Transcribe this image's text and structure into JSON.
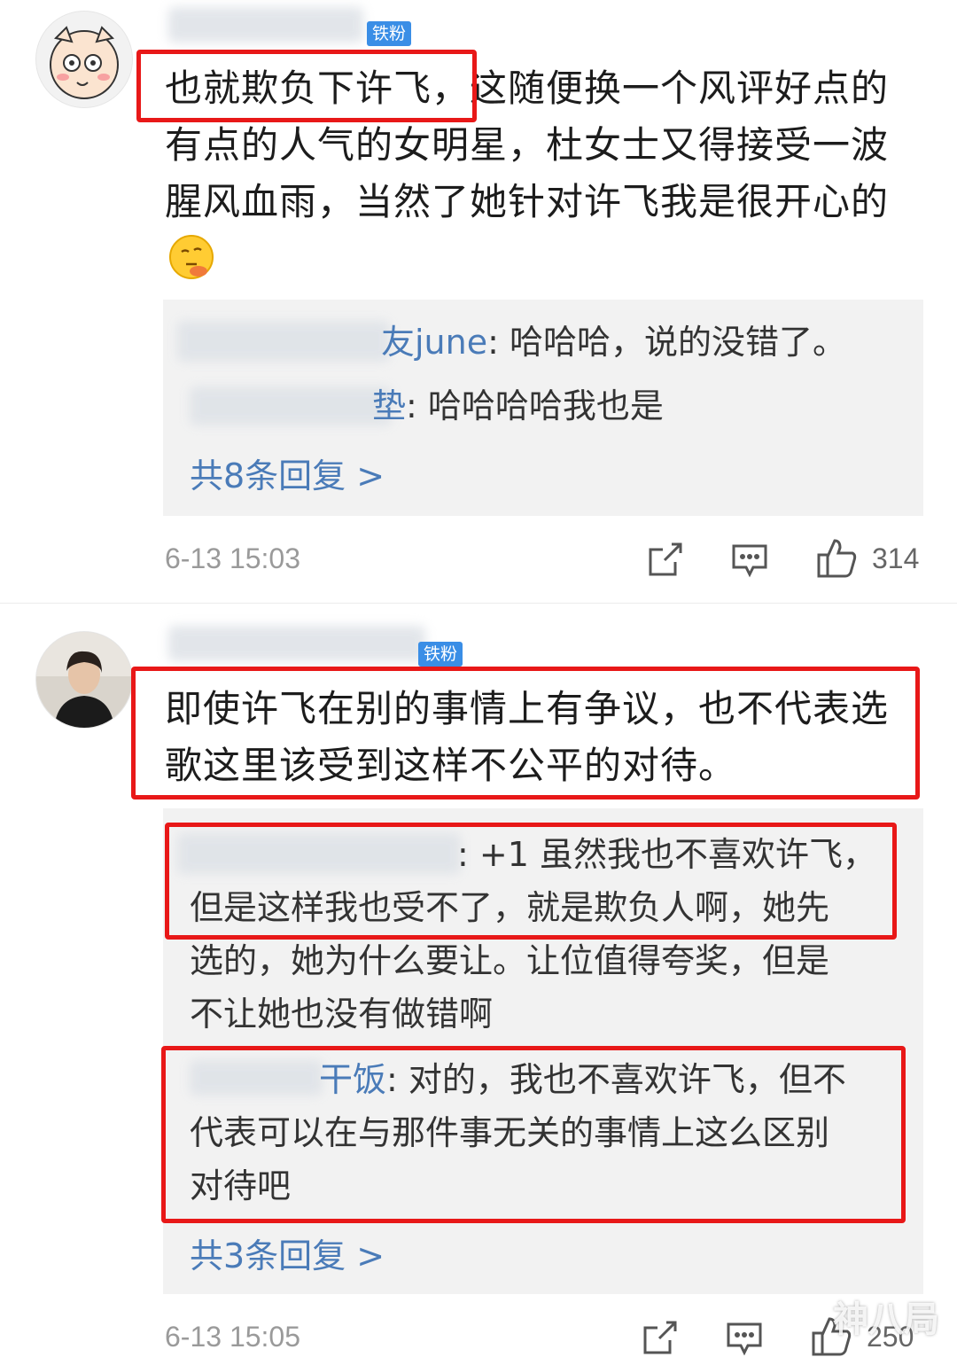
{
  "comments": [
    {
      "badge": "铁粉",
      "text_lines": [
        "也就欺负下许飞，这随便换一个风评好点的",
        "有点的人气的女明星，杜女士又得接受一波",
        "腥风血雨，当然了她针对许飞我是很开心的"
      ],
      "emoji": "thinking-emoji",
      "replies": [
        {
          "name_tail": "友june",
          "sep": ": ",
          "text": "哈哈哈，说的没错了。"
        },
        {
          "name_tail": "垫",
          "sep": ": ",
          "text": "哈哈哈哈我也是"
        }
      ],
      "more_replies": "共8条回复 >",
      "time": "6-13 15:03",
      "likes": "314"
    },
    {
      "badge": "铁粉",
      "text_lines": [
        "即使许飞在别的事情上有争议，也不代表选",
        "歌这里该受到这样不公平的对待。"
      ],
      "replies_text": [
        ": +1 虽然我也不喜欢许飞，",
        "但是这样我也受不了，就是欺负人啊，她先",
        "选的，她为什么要让。让位值得夸奖，但是",
        "不让她也没有做错啊"
      ],
      "reply2_name_tail": "干饭",
      "reply2_lines": [
        ": 对的，我也不喜欢许飞，但不",
        "代表可以在与那件事无关的事情上这么区别",
        "对待吧"
      ],
      "more_replies": "共3条回复 >",
      "time": "6-13 15:05",
      "likes": "250"
    }
  ],
  "watermark": "神八局",
  "colors": {
    "highlight": "#e81818",
    "link": "#4a7bb8",
    "badge": "#3a8ee6"
  }
}
